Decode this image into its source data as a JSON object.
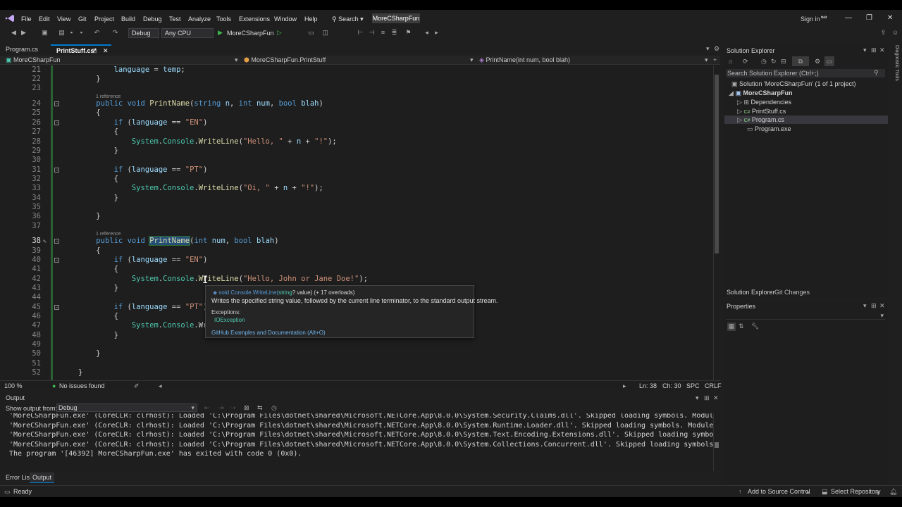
{
  "menubar": {
    "items": [
      "File",
      "Edit",
      "View",
      "Git",
      "Project",
      "Build",
      "Debug",
      "Test",
      "Analyze",
      "Tools",
      "Extensions",
      "Window",
      "Help"
    ],
    "search_label": "Search",
    "project_name": "MoreCSharpFun",
    "signin_label": "Sign in"
  },
  "toolbar": {
    "config": "Debug",
    "platform": "Any CPU",
    "run_target": "MoreCSharpFun"
  },
  "tabs": [
    {
      "label": "Program.cs",
      "active": false
    },
    {
      "label": "PrintStuff.cs*",
      "active": true
    }
  ],
  "navbar": {
    "project": "MoreCSharpFun",
    "class": "MoreCSharpFun.PrintStuff",
    "member": "PrintName(int num, bool blah)"
  },
  "code": {
    "ref_label": "1 reference",
    "lines": [
      {
        "n": "21",
        "text": "        language = temp;"
      },
      {
        "n": "22",
        "text": "    }"
      },
      {
        "n": "23",
        "text": ""
      },
      {
        "n": "24",
        "text": "    public void PrintName(string n, int num, bool blah)"
      },
      {
        "n": "25",
        "text": "    {"
      },
      {
        "n": "26",
        "text": "        if (language == \"EN\")"
      },
      {
        "n": "27",
        "text": "        {"
      },
      {
        "n": "28",
        "text": "            System.Console.WriteLine(\"Hello, \" + n + \"!\");"
      },
      {
        "n": "29",
        "text": "        }"
      },
      {
        "n": "30",
        "text": ""
      },
      {
        "n": "31",
        "text": "        if (language == \"PT\")"
      },
      {
        "n": "32",
        "text": "        {"
      },
      {
        "n": "33",
        "text": "            System.Console.WriteLine(\"Oi, \" + n + \"!\");"
      },
      {
        "n": "34",
        "text": "        }"
      },
      {
        "n": "35",
        "text": ""
      },
      {
        "n": "36",
        "text": "    }"
      },
      {
        "n": "37",
        "text": ""
      },
      {
        "n": "38",
        "text": "    public void PrintName(int num, bool blah)"
      },
      {
        "n": "39",
        "text": "    {"
      },
      {
        "n": "40",
        "text": "        if (language == \"EN\")"
      },
      {
        "n": "41",
        "text": "        {"
      },
      {
        "n": "42",
        "text": "            System.Console.WriteLine(\"Hello, John or Jane Doe!\");"
      },
      {
        "n": "43",
        "text": "        }"
      },
      {
        "n": "44",
        "text": ""
      },
      {
        "n": "45",
        "text": "        if (language == \"PT\")"
      },
      {
        "n": "46",
        "text": "        {"
      },
      {
        "n": "47",
        "text": "            System.Console.Wr"
      },
      {
        "n": "48",
        "text": "        }"
      },
      {
        "n": "49",
        "text": ""
      },
      {
        "n": "50",
        "text": "    }"
      },
      {
        "n": "51",
        "text": ""
      },
      {
        "n": "52",
        "text": "}"
      }
    ]
  },
  "tooltip": {
    "signature_prefix": "void Console.WriteLine(",
    "signature_type": "string",
    "signature_suffix": "? value) (+ 17 overloads)",
    "description": "Writes the specified string value, followed by the current line terminator, to the standard output stream.",
    "exceptions_label": "Exceptions:",
    "exception": "IOException",
    "link": "GitHub Examples and Documentation (Alt+O)"
  },
  "editor_status": {
    "zoom": "100 %",
    "issues": "No issues found",
    "ln": "Ln: 38",
    "ch": "Ch: 30",
    "spc": "SPC",
    "eol": "CRLF"
  },
  "output": {
    "title": "Output",
    "show_from_label": "Show output from:",
    "source": "Debug",
    "lines": [
      "'MoreCSharpFun.exe' (CoreCLR: clrhost): Loaded 'C:\\Program Files\\dotnet\\shared\\Microsoft.NETCore.App\\8.0.0\\System.Security.Claims.dll'. Skipped loading symbols. Module",
      "'MoreCSharpFun.exe' (CoreCLR: clrhost): Loaded 'C:\\Program Files\\dotnet\\shared\\Microsoft.NETCore.App\\8.0.0\\System.Runtime.Loader.dll'. Skipped loading symbols. Module",
      "'MoreCSharpFun.exe' (CoreCLR: clrhost): Loaded 'C:\\Program Files\\dotnet\\shared\\Microsoft.NETCore.App\\8.0.0\\System.Text.Encoding.Extensions.dll'. Skipped loading symbo",
      "'MoreCSharpFun.exe' (CoreCLR: clrhost): Loaded 'C:\\Program Files\\dotnet\\shared\\Microsoft.NETCore.App\\8.0.0\\System.Collections.Concurrent.dll'. Skipped loading symbols",
      "The program '[46392] MoreCSharpFun.exe' has exited with code 0 (0x0)."
    ]
  },
  "bottom_tabs": [
    "Error List",
    "Output"
  ],
  "solution_explorer": {
    "title": "Solution Explorer",
    "search_placeholder": "Search Solution Explorer (Ctrl+;)",
    "solution": "Solution 'MoreCSharpFun' (1 of 1 project)",
    "project": "MoreCSharpFun",
    "items": [
      "Dependencies",
      "PrintStuff.cs",
      "Program.cs",
      "Program.exe"
    ],
    "tabs": [
      "Solution Explorer",
      "Git Changes"
    ]
  },
  "properties": {
    "title": "Properties"
  },
  "side_strip": {
    "label": "Diagnostic Tools"
  },
  "statusbar": {
    "ready": "Ready",
    "source_control": "Add to Source Control",
    "repository": "Select Repository"
  }
}
